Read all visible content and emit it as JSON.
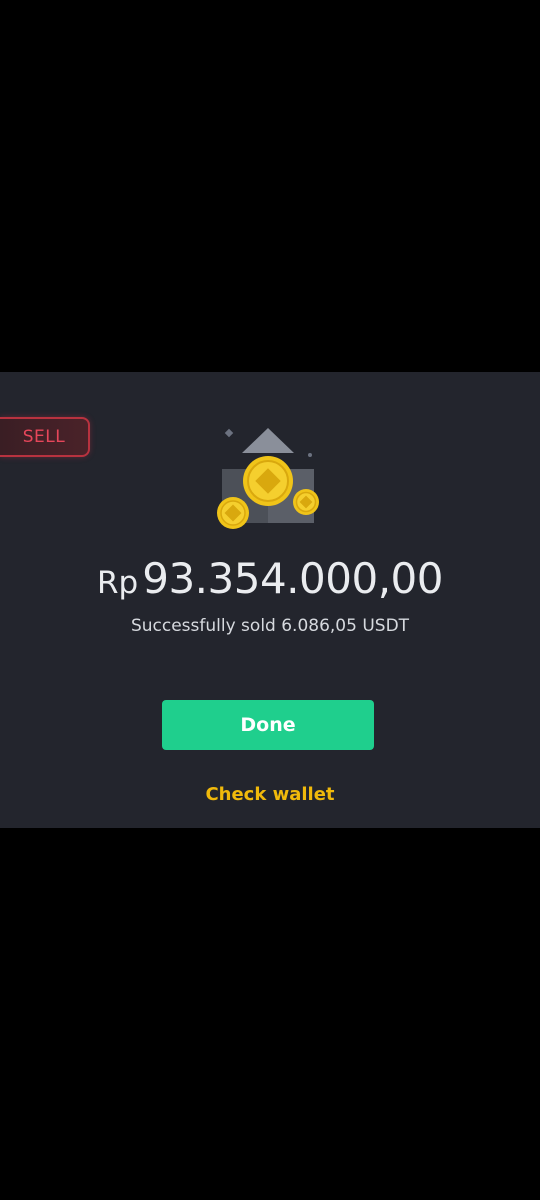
{
  "badge": {
    "label": "SELL",
    "color": "#e6465a"
  },
  "result": {
    "currency": "Rp",
    "amount": "93.354.000,00",
    "message": "Successfully sold 6.086,05 USDT"
  },
  "actions": {
    "done_label": "Done",
    "check_wallet_label": "Check wallet"
  },
  "colors": {
    "panel_bg": "#23252d",
    "primary_button": "#1fcf8d",
    "link": "#f0b90b",
    "coin": "#f0c419"
  },
  "icons": {
    "illustration": "coins-wallet-illustration"
  }
}
